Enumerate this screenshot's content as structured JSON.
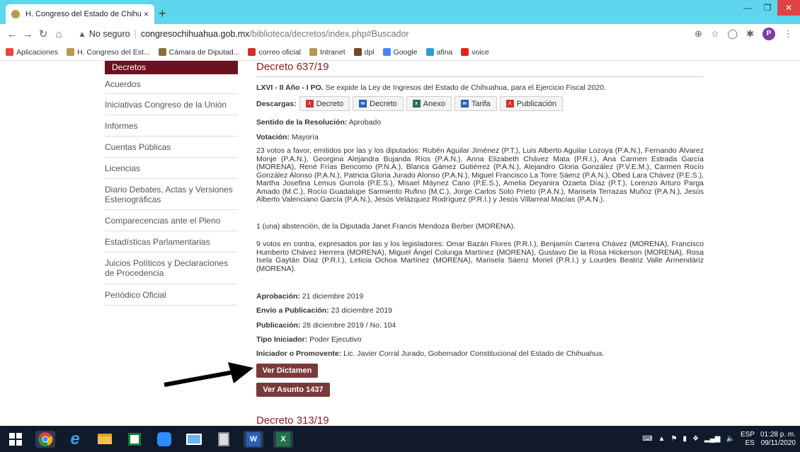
{
  "browser": {
    "tab_title": "H. Congreso del Estado de Chihu",
    "tab_close": "×",
    "new_tab": "+",
    "url_warning": "No seguro",
    "url_host": "congresochihuahua.gob.mx",
    "url_path": "/biblioteca/decretos/index.php#Buscador",
    "profile_initial": "P"
  },
  "bookmarks": [
    {
      "label": "Aplicaciones",
      "icon": "apps-grid-icon",
      "color": "#e8453c"
    },
    {
      "label": "H. Congreso del Est...",
      "icon": "congress-seal-icon",
      "color": "#b8984c"
    },
    {
      "label": "Cámara de Diputad...",
      "icon": "camara-seal-icon",
      "color": "#8a6d3b"
    },
    {
      "label": "correo oficial",
      "icon": "x-logo-icon",
      "color": "#d0322a"
    },
    {
      "label": "Intranet",
      "icon": "congress-seal-icon",
      "color": "#b8984c"
    },
    {
      "label": "dpl",
      "icon": "person-icon",
      "color": "#6b4a2a"
    },
    {
      "label": "Google",
      "icon": "google-g-icon",
      "color": "#4285f4"
    },
    {
      "label": "afina",
      "icon": "afina-logo-icon",
      "color": "#2a9fd6"
    },
    {
      "label": "voice",
      "icon": "youtube-icon",
      "color": "#e62117"
    }
  ],
  "sidebar": {
    "active": "Decretos",
    "items": [
      "Acuerdos",
      "Iniciativas Congreso de la Unión",
      "Informes",
      "Cuentas Públicas",
      "Licencias",
      "Diario Debates, Actas y Versiones Estenográficas",
      "Comparecencias ante el Pleno",
      "Estadísticas Parlamentarias",
      "Juicios Políticos y Declaraciones de Procedencia",
      "Periódico Oficial"
    ]
  },
  "decree": {
    "title": "Decreto 637/19",
    "legislature": "LXVI - II Año - I PO.",
    "summary": "Se expide la Ley de Ingresos del Estado de Chihuahua, para el Ejercicio Fiscal 2020.",
    "downloads_label": "Descargas:",
    "downloads": [
      {
        "label": "Decreto",
        "type": "pdf"
      },
      {
        "label": "Decreto",
        "type": "doc"
      },
      {
        "label": "Anexo",
        "type": "xls"
      },
      {
        "label": "Tarifa",
        "type": "doc"
      },
      {
        "label": "Publicación",
        "type": "pdf"
      }
    ],
    "sentido_label": "Sentido de la Resolución:",
    "sentido_value": "Aprobado",
    "votacion_label": "Votación:",
    "votacion_value": "Mayoría",
    "votes_favor": "23 votos a favor, emitidos por las y los diputados: Rubén Aguilar Jiménez (P.T.), Luis Alberto Aguilar Lozoya (P.A.N.), Fernando Álvarez Monje (P.A.N.), Georgina Alejandra Bujanda Ríos (P.A.N.), Anna Elizabeth Chávez Mata (P.R.I.), Ana Carmen Estrada García (MORENA), René Frías Bencomo (P.N.A.), Blanca Gámez Gutiérrez (P.A.N.), Alejandro Gloria González (P.V.E.M.), Carmen Rocío González Alonso (P.A.N.), Patricia Gloria Jurado Alonso (P.A.N.), Miguel Francisco La Torre Sáenz (P.A.N.), Obed Lara Chávez (P.E.S.), Martha Josefina Lemus Gurrola (P.E.S.), Misael Máynez Cano (P.E.S.), Amelia Deyanira Ozaeta Díaz (P.T.), Lorenzo Arturo Parga Amado (M.C.), Rocío Guadalupe Sarmiento Rufino (M.C.), Jorge Carlos Soto Prieto (P.A.N.), Marisela Terrazas Muñoz (P.A.N.), Jesús Alberto Valenciano García (P.A.N.), Jesús Velázquez Rodríguez (P.R.I.) y Jesús Villarreal Macías (P.A.N.).",
    "abstention": "1 (una) abstención, de la Diputada Janet Francis Mendoza Berber (MORENA).",
    "votes_contra": "9 votos en contra, expresados por las y los legisladores: Omar Bazán Flores (P.R.I.), Benjamín Carrera Chávez (MORENA), Francisco Humberto Chávez Herrera (MORENA), Miguel Ángel Colunga Martínez (MORENA), Gustavo De la Rosa Hickerson (MORENA), Rosa Isela Gaytán Díaz (P.R.I.), Leticia Ochoa Martínez (MORENA), Marisela Sáenz Moriel (P.R.I.) y Lourdes Beatriz Valle Armendáriz (MORENA).",
    "aprobacion_label": "Aprobación:",
    "aprobacion_value": "21 diciembre 2019",
    "envio_label": "Envío a Publicación:",
    "envio_value": "23 diciembre 2019",
    "publicacion_label": "Publicación:",
    "publicacion_value": "28 diciembre 2019 / No. 104",
    "tipo_label": "Tipo Iniciador:",
    "tipo_value": "Poder Ejecutivo",
    "iniciador_label": "Iniciador o Promovente:",
    "iniciador_value": "Lic. Javier Corral Jurado, Gobernador Constitucional del Estado de Chihuahua.",
    "btn_dictamen": "Ver Dictamen",
    "btn_asunto": "Ver Asunto 1437"
  },
  "next_decree_title": "Decreto 313/19",
  "taskbar": {
    "lang_top": "ESP",
    "lang_bottom": "ES",
    "time": "01:28 p. m.",
    "date": "09/11/2020"
  }
}
